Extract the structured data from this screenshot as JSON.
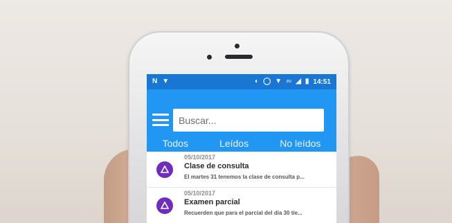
{
  "status_bar": {
    "left_icons": [
      "n-icon",
      "shield-icon"
    ],
    "right_icons": [
      "vibrate-icon",
      "alarm-icon",
      "wifi-icon",
      "signal-icon",
      "battery-icon"
    ],
    "network": "3G",
    "time": "14:51"
  },
  "search": {
    "placeholder": "Buscar..."
  },
  "tabs": [
    "Todos",
    "Leídos",
    "No leídos"
  ],
  "notifications": [
    {
      "date": "05/10/2017",
      "title": "Clase de consulta",
      "body": "El martes 31 tenemos la clase de consulta p...",
      "icon": "bell-icon"
    },
    {
      "date": "05/10/2017",
      "title": "Examen parcial",
      "body": "Recuerden que para el parcial del día 30 tie...",
      "icon": "bell-icon"
    }
  ],
  "colors": {
    "status_bar": "#1976d2",
    "toolbar": "#2196f3",
    "item_icon": "#6f2dbd"
  }
}
